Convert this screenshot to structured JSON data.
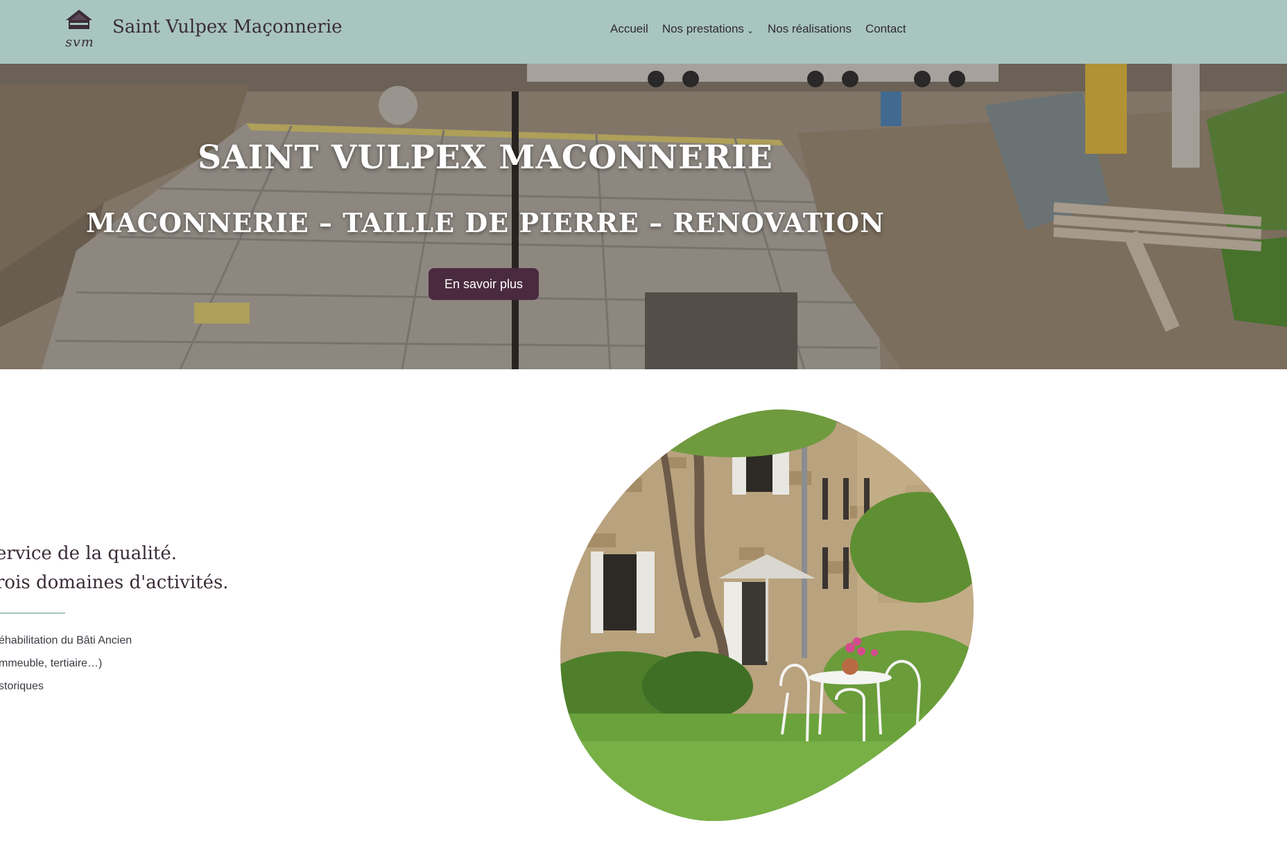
{
  "header": {
    "logo_mark": "svm",
    "site_title": "Saint Vulpex Maçonnerie",
    "nav": [
      {
        "label": "Accueil",
        "has_dropdown": false
      },
      {
        "label": "Nos prestations",
        "has_dropdown": true
      },
      {
        "label": "Nos réalisations",
        "has_dropdown": false
      },
      {
        "label": "Contact",
        "has_dropdown": false
      }
    ],
    "colors": {
      "background": "#a8c5bf",
      "text": "#3a2c38"
    }
  },
  "hero": {
    "title": "SAINT VULPEX MACONNERIE",
    "subtitle": "MACONNERIE – TAILLE DE PIERRE – RENOVATION",
    "button_label": "En savoir plus",
    "button_color": "#4a2a3f"
  },
  "content": {
    "lead_lines": [
      "ervice de la qualité.",
      "rois domaines d'activités."
    ],
    "services": [
      "éhabilitation du Bâti Ancien",
      "mmeuble, tertiaire…)",
      "storiques"
    ],
    "divider_color": "#a8c5bf"
  }
}
